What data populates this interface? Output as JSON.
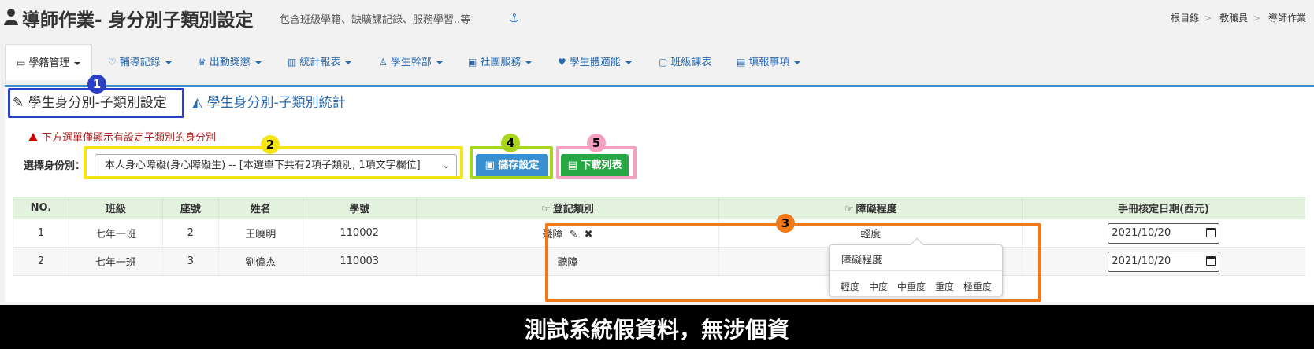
{
  "header": {
    "title": "導師作業- 身分別子類別設定",
    "subtitle": "包含班級學籍、缺曠課記錄、服務學習..等",
    "anchor_icon": "anchor-icon",
    "breadcrumb": [
      "根目錄",
      "教職員",
      "導師作業"
    ]
  },
  "menu": [
    {
      "label": "學籍管理",
      "icon": "id-card-icon",
      "dropdown": true,
      "active": true
    },
    {
      "label": "輔導記錄",
      "icon": "heart-icon",
      "dropdown": true
    },
    {
      "label": "出勤獎懲",
      "icon": "trophy-icon",
      "dropdown": true
    },
    {
      "label": "統計報表",
      "icon": "bar-chart-icon",
      "dropdown": true
    },
    {
      "label": "學生幹部",
      "icon": "person-icon",
      "dropdown": true
    },
    {
      "label": "社團服務",
      "icon": "gift-icon",
      "dropdown": true
    },
    {
      "label": "學生體適能",
      "icon": "heartbeat-icon",
      "dropdown": true
    },
    {
      "label": "班級課表",
      "icon": "calendar-icon",
      "dropdown": false
    },
    {
      "label": "填報事項",
      "icon": "form-icon",
      "dropdown": true
    }
  ],
  "subtabs": [
    {
      "label": "學生身分別-子類別設定",
      "icon": "edit-icon",
      "active": true
    },
    {
      "label": "學生身分別-子類別統計",
      "icon": "area-chart-icon",
      "active": false
    }
  ],
  "warning": "下方選單僅顯示有設定子類別的身分別",
  "selector": {
    "label": "選擇身份別：",
    "value": "本人身心障礙(身心障礙生) -- [本選單下共有2項子類別, 1項文字欄位]"
  },
  "buttons": {
    "save": "儲存設定",
    "download": "下載列表"
  },
  "table": {
    "headers": [
      "NO.",
      "班級",
      "座號",
      "姓名",
      "學號",
      "登記類別",
      "障礙程度",
      "手冊核定日期(西元)"
    ],
    "rows": [
      {
        "no": "1",
        "class": "七年一班",
        "seat": "2",
        "name": "王曉明",
        "id": "110002",
        "category": "殘障",
        "degree": "輕度",
        "date": "2021/10/20"
      },
      {
        "no": "2",
        "class": "七年一班",
        "seat": "3",
        "name": "劉偉杰",
        "id": "110003",
        "category": "聽障",
        "degree": "",
        "date": "2021/10/20"
      }
    ]
  },
  "popover": {
    "title": "障礙程度",
    "options": [
      "輕度",
      "中度",
      "中重度",
      "重度",
      "極重度"
    ]
  },
  "annotations": {
    "badges": [
      "1",
      "2",
      "3",
      "4",
      "5"
    ],
    "colors": {
      "1": "#2b3fc4",
      "2": "#f5e613",
      "3": "#f07a1a",
      "4": "#a8d61c",
      "5": "#f4a0c0"
    }
  },
  "colors": {
    "link": "#2a6ab0",
    "primary": "#3a8fd0",
    "success": "#28a745",
    "warning": "#b22222",
    "table_header": "#e3f1df"
  },
  "caption": "測試系統假資料，無涉個資"
}
